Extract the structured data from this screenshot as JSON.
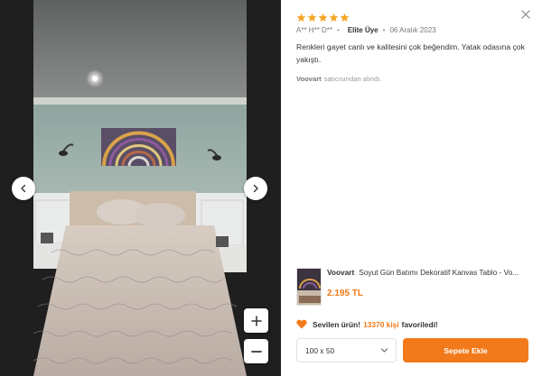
{
  "gallery": {
    "prev_icon": "chevron-left-icon",
    "next_icon": "chevron-right-icon",
    "zoom_in_icon": "plus-icon",
    "zoom_out_icon": "minus-icon"
  },
  "review": {
    "rating": 5,
    "rating_max": 5,
    "user": "A** H** D**",
    "badge": "Elite Üye",
    "date": "06 Aralık 2023",
    "text": "Renkleri gayet canlı ve kalitesini çok beğendim. Yatak odasına çok yakıştı.",
    "seller_name": "Voovart",
    "seller_suffix": "satıcısından alındı."
  },
  "product": {
    "brand": "Voovart",
    "name": "Soyut Gün Batımı Dekoratif Kanvas Tablo - Vo...",
    "price": "2.195 TL"
  },
  "favorites": {
    "prefix": "Sevilen ürün!",
    "count": "13370 kişi",
    "suffix": "favoriledi!"
  },
  "size": {
    "selected": "100 x 50"
  },
  "cart": {
    "label": "Sepete Ekle"
  },
  "colors": {
    "accent": "#f27a1a",
    "star": "#f5a623"
  }
}
